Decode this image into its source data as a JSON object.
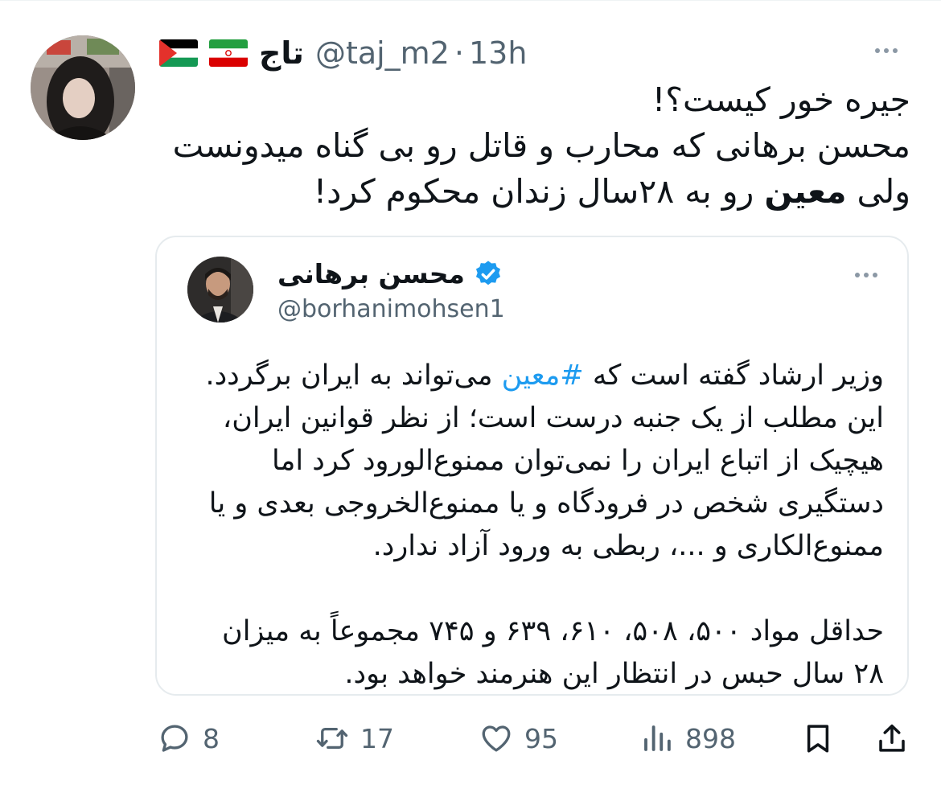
{
  "tweet": {
    "author_name": "تاج",
    "flags": [
      "palestine-flag",
      "iran-flag"
    ],
    "handle": "@taj_m2",
    "separator": "·",
    "time": "13h",
    "lines": [
      "جیره خور کیست؟!",
      "محسن برهانی که محارب و قاتل رو بی گناه میدونست"
    ],
    "line3_start": "ولی ",
    "line3_bold": "معین",
    "line3_end": " رو به ۲۸سال زندان محکوم کرد!"
  },
  "quoted": {
    "author_name": "محسن برهانی",
    "handle": "@borhanimohsen1",
    "line1_start": "وزیر ارشاد گفته است که ",
    "hashtag": "#معین",
    "line1_end": " می‌تواند به ایران برگردد.",
    "lines": [
      "این مطلب از یک جنبه درست است؛ از نظر قوانین ایران،",
      "هیچیک از اتباع ایران را نمی‌توان ممنوع‌الورود کرد اما",
      "دستگیری شخص در فرودگاه و یا ممنوع‌الخروجی بعدی و یا",
      "ممنوع‌الکاری و ...، ربطی به ورود آزاد ندارد.",
      "",
      "حداقل مواد ۵۰۰، ۵۰۸، ۶۱۰، ۶۳۹ و ۷۴۵ مجموعاً به میزان",
      "۲۸ سال حبس در انتظار این هنرمند خواهد بود."
    ]
  },
  "actions": {
    "replies": "8",
    "retweets": "17",
    "likes": "95",
    "views": "898"
  },
  "colors": {
    "text": "#0f1419",
    "secondary": "#536471",
    "link": "#1d9bf0",
    "border": "#e6ebee"
  }
}
